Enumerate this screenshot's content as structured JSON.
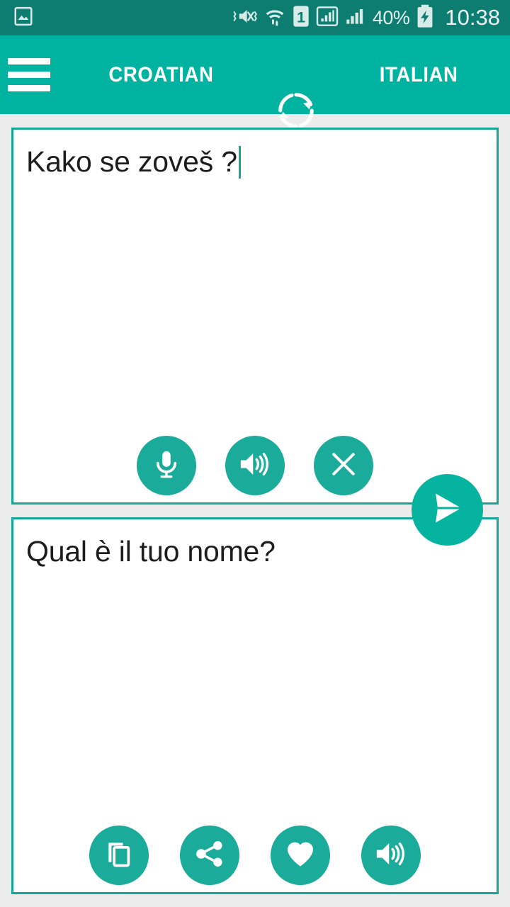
{
  "status_bar": {
    "gallery_icon": "image-icon",
    "vibrate_mute_icon": "volume-mute-vibrate-icon",
    "wifi_icon": "wifi-transfer-icon",
    "sim_icon": "sim-1-icon",
    "signal_icon_1": "signal-bars-boxed-icon",
    "signal_icon_2": "signal-bars-icon",
    "battery_percent": "40%",
    "battery_icon": "battery-charging-icon",
    "clock": "10:38",
    "background_color": "#0d7d72"
  },
  "app_bar": {
    "menu_icon": "hamburger-menu-icon",
    "source_language": "CROATIAN",
    "swap_icon": "swap-languages-icon",
    "target_language": "ITALIAN",
    "background_color": "#00b3a1"
  },
  "source_card": {
    "text": "Kako se zoveš ?",
    "caret_visible": true,
    "actions": [
      {
        "name": "microphone-button",
        "icon": "microphone-icon"
      },
      {
        "name": "speak-button",
        "icon": "speaker-icon"
      },
      {
        "name": "clear-button",
        "icon": "close-x-icon"
      }
    ],
    "border_color": "#16a698"
  },
  "send_button": {
    "name": "translate-send-button",
    "icon": "send-paper-plane-icon",
    "color": "#06b39f"
  },
  "target_card": {
    "text": "Qual è il tuo nome?",
    "actions": [
      {
        "name": "copy-button",
        "icon": "copy-icon"
      },
      {
        "name": "share-button",
        "icon": "share-icon"
      },
      {
        "name": "favorite-button",
        "icon": "heart-icon"
      },
      {
        "name": "speak-button",
        "icon": "speaker-icon"
      }
    ],
    "border_color": "#16a698"
  },
  "theme": {
    "page_background": "#ececec",
    "accent": "#00b3a1",
    "button_fill": "#1aab9b",
    "text_color": "#1d1d1d"
  }
}
